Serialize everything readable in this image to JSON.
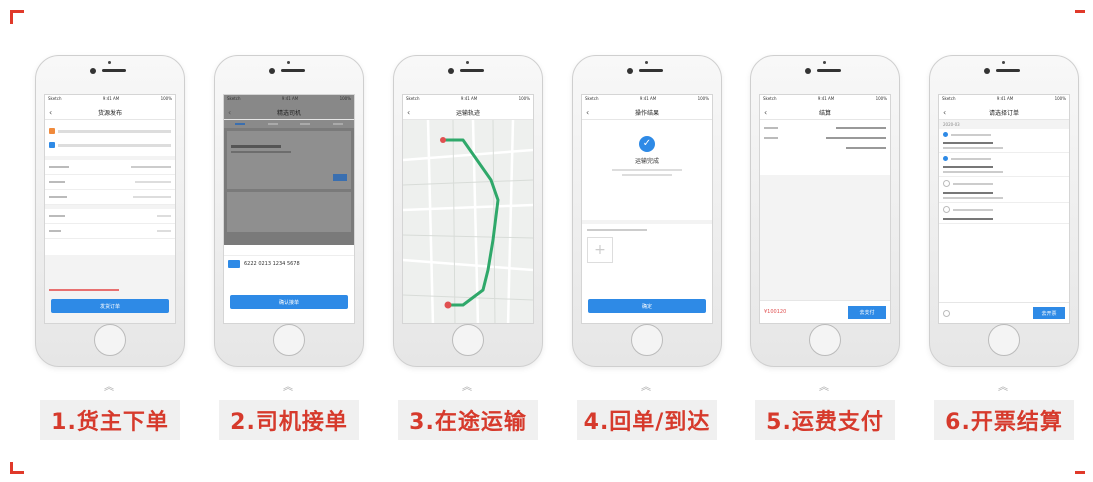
{
  "accent": "#e0392a",
  "phone_status": {
    "carrier": "Sketch",
    "time": "9:41 AM",
    "battery": "100%"
  },
  "steps": [
    {
      "label": "1.货主下单",
      "nav_title": "货源发布",
      "button": "发货订单"
    },
    {
      "label": "2.司机接单",
      "nav_title": "精选司机",
      "card_number": "6222 0213 1234 5678",
      "button": "确认接单"
    },
    {
      "label": "3.在途运输",
      "nav_title": "运输轨迹"
    },
    {
      "label": "4.回单/到达",
      "nav_title": "操作结果",
      "result": "运输完成",
      "button": "确定"
    },
    {
      "label": "5.运费支付",
      "nav_title": "结算",
      "total": "¥100120",
      "button": "去支付"
    },
    {
      "label": "6.开票结算",
      "nav_title": "请选择订单",
      "month": "2020-03",
      "button": "去开票"
    }
  ]
}
